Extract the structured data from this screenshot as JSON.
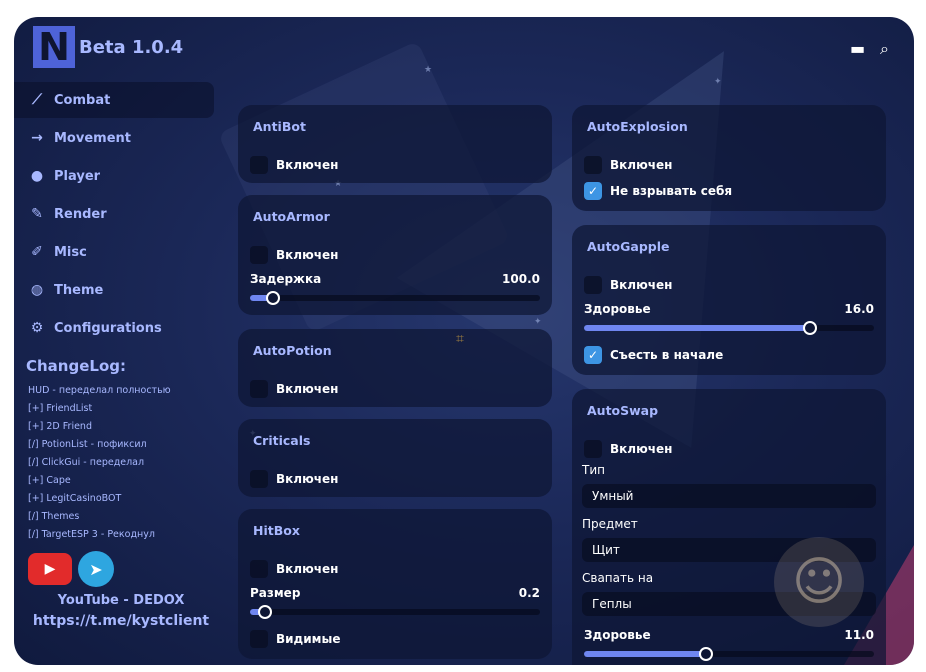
{
  "app": {
    "logo_letter": "N",
    "title": "Beta 1.0.4",
    "accent": "#a8b8ff",
    "icons": [
      "folder-icon",
      "search-icon"
    ]
  },
  "sidebar": {
    "items": [
      {
        "label": "Combat",
        "icon": "sword-icon"
      },
      {
        "label": "Movement",
        "icon": "arrow-move-icon"
      },
      {
        "label": "Player",
        "icon": "user-icon"
      },
      {
        "label": "Render",
        "icon": "pen-icon"
      },
      {
        "label": "Misc",
        "icon": "pencil-icon"
      },
      {
        "label": "Theme",
        "icon": "palette-icon"
      },
      {
        "label": "Configurations",
        "icon": "gear-icon"
      }
    ],
    "changelog_title": "ChangeLog:",
    "changelog": [
      "HUD - переделал полностью",
      "[+] FriendList",
      "[+] 2D Friend",
      "[/] PotionList - пофиксил",
      "[/] ClickGui - переделал",
      "[+] Cape",
      "[+] LegitCasinoBOT",
      "[/] Themes",
      "[/] TargetESP 3 - Рекоднул"
    ],
    "youtube": "YouTube - DEDOX",
    "telegram": "https://t.me/kystclient"
  },
  "modules": {
    "antibot": {
      "title": "AntiBot",
      "enabled": "Включен"
    },
    "autoarmor": {
      "title": "AutoArmor",
      "enabled": "Включен",
      "delay_label": "Задержка",
      "delay_value": "100.0",
      "delay_fraction": 0.08
    },
    "autopotion": {
      "title": "AutoPotion",
      "enabled": "Включен"
    },
    "criticals": {
      "title": "Criticals",
      "enabled": "Включен"
    },
    "hitbox": {
      "title": "HitBox",
      "enabled": "Включен",
      "size_label": "Размер",
      "size_value": "0.2",
      "size_fraction": 0.05,
      "visible": "Видимые"
    },
    "autoexplosion": {
      "title": "AutoExplosion",
      "enabled": "Включен",
      "no_self": "Не взрывать себя"
    },
    "autogapple": {
      "title": "AutoGapple",
      "enabled": "Включен",
      "health_label": "Здоровье",
      "health_value": "16.0",
      "health_fraction": 0.78,
      "eat_first": "Съесть в начале"
    },
    "autoswap": {
      "title": "AutoSwap",
      "enabled": "Включен",
      "type_label": "Тип",
      "type_value": "Умный",
      "item_label": "Предмет",
      "item_value": "Щит",
      "swap_label": "Свапать на",
      "swap_value": "Геплы",
      "health_label": "Здоровье",
      "health_value": "11.0",
      "health_fraction": 0.42
    }
  }
}
